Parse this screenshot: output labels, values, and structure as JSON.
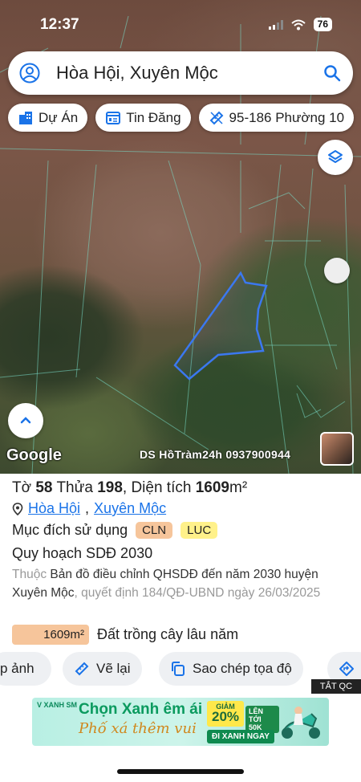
{
  "status_bar": {
    "time": "12:37",
    "battery": "76"
  },
  "search": {
    "query": "Hòa Hội, Xuyên Mộc"
  },
  "chips": [
    {
      "label": "Dự Án",
      "icon": "building-icon"
    },
    {
      "label": "Tin Đăng",
      "icon": "listing-icon"
    },
    {
      "label": "95-186 Phường 10",
      "icon": "ruler-icon"
    }
  ],
  "map": {
    "attribution": "Google",
    "watermark": "DS HồTràm24h 0937900944",
    "parcel_color": "#3b78f0"
  },
  "parcel": {
    "to_label": "Tờ",
    "to_value": "58",
    "thua_label": "Thửa",
    "thua_value": "198",
    "area_label": "Diện tích",
    "area_value": "1609",
    "area_unit": "m²",
    "commune": "Hòa Hội",
    "district": "Xuyên Mộc",
    "separator": ",",
    "purpose_label": "Mục đích sử dụng",
    "purpose_tags": [
      "CLN",
      "LUC"
    ],
    "plan_title": "Quy hoạch SDĐ 2030",
    "plan_prefix": "Thuộc",
    "plan_doc": "Bản đồ điều chỉnh QHSDĐ đến năm 2030 huyện Xuyên Mộc",
    "plan_decision": ", quyết định 184/QĐ-UBND ngày 26/03/2025",
    "area_bar_value": "1609m²",
    "area_bar_fraction": 1.0,
    "area_bar_desc": "Đất trồng cây lâu năm"
  },
  "actions": [
    {
      "label": "p ảnh"
    },
    {
      "label": "Vẽ lại"
    },
    {
      "label": "Sao chép tọa độ"
    }
  ],
  "ad_label": "TẮT QC",
  "ad": {
    "brand": "V XANH SM",
    "title": "Chọn Xanh êm ái",
    "subtitle": "Phố xá thêm vui",
    "discount_word": "GIẢM",
    "discount": "20%",
    "max": "LÊN TỚI 50K",
    "cta": "ĐI XANH NGAY"
  },
  "colors": {
    "accent": "#1a73e8",
    "cln": "#f6c59b",
    "luc": "#fff18a"
  }
}
